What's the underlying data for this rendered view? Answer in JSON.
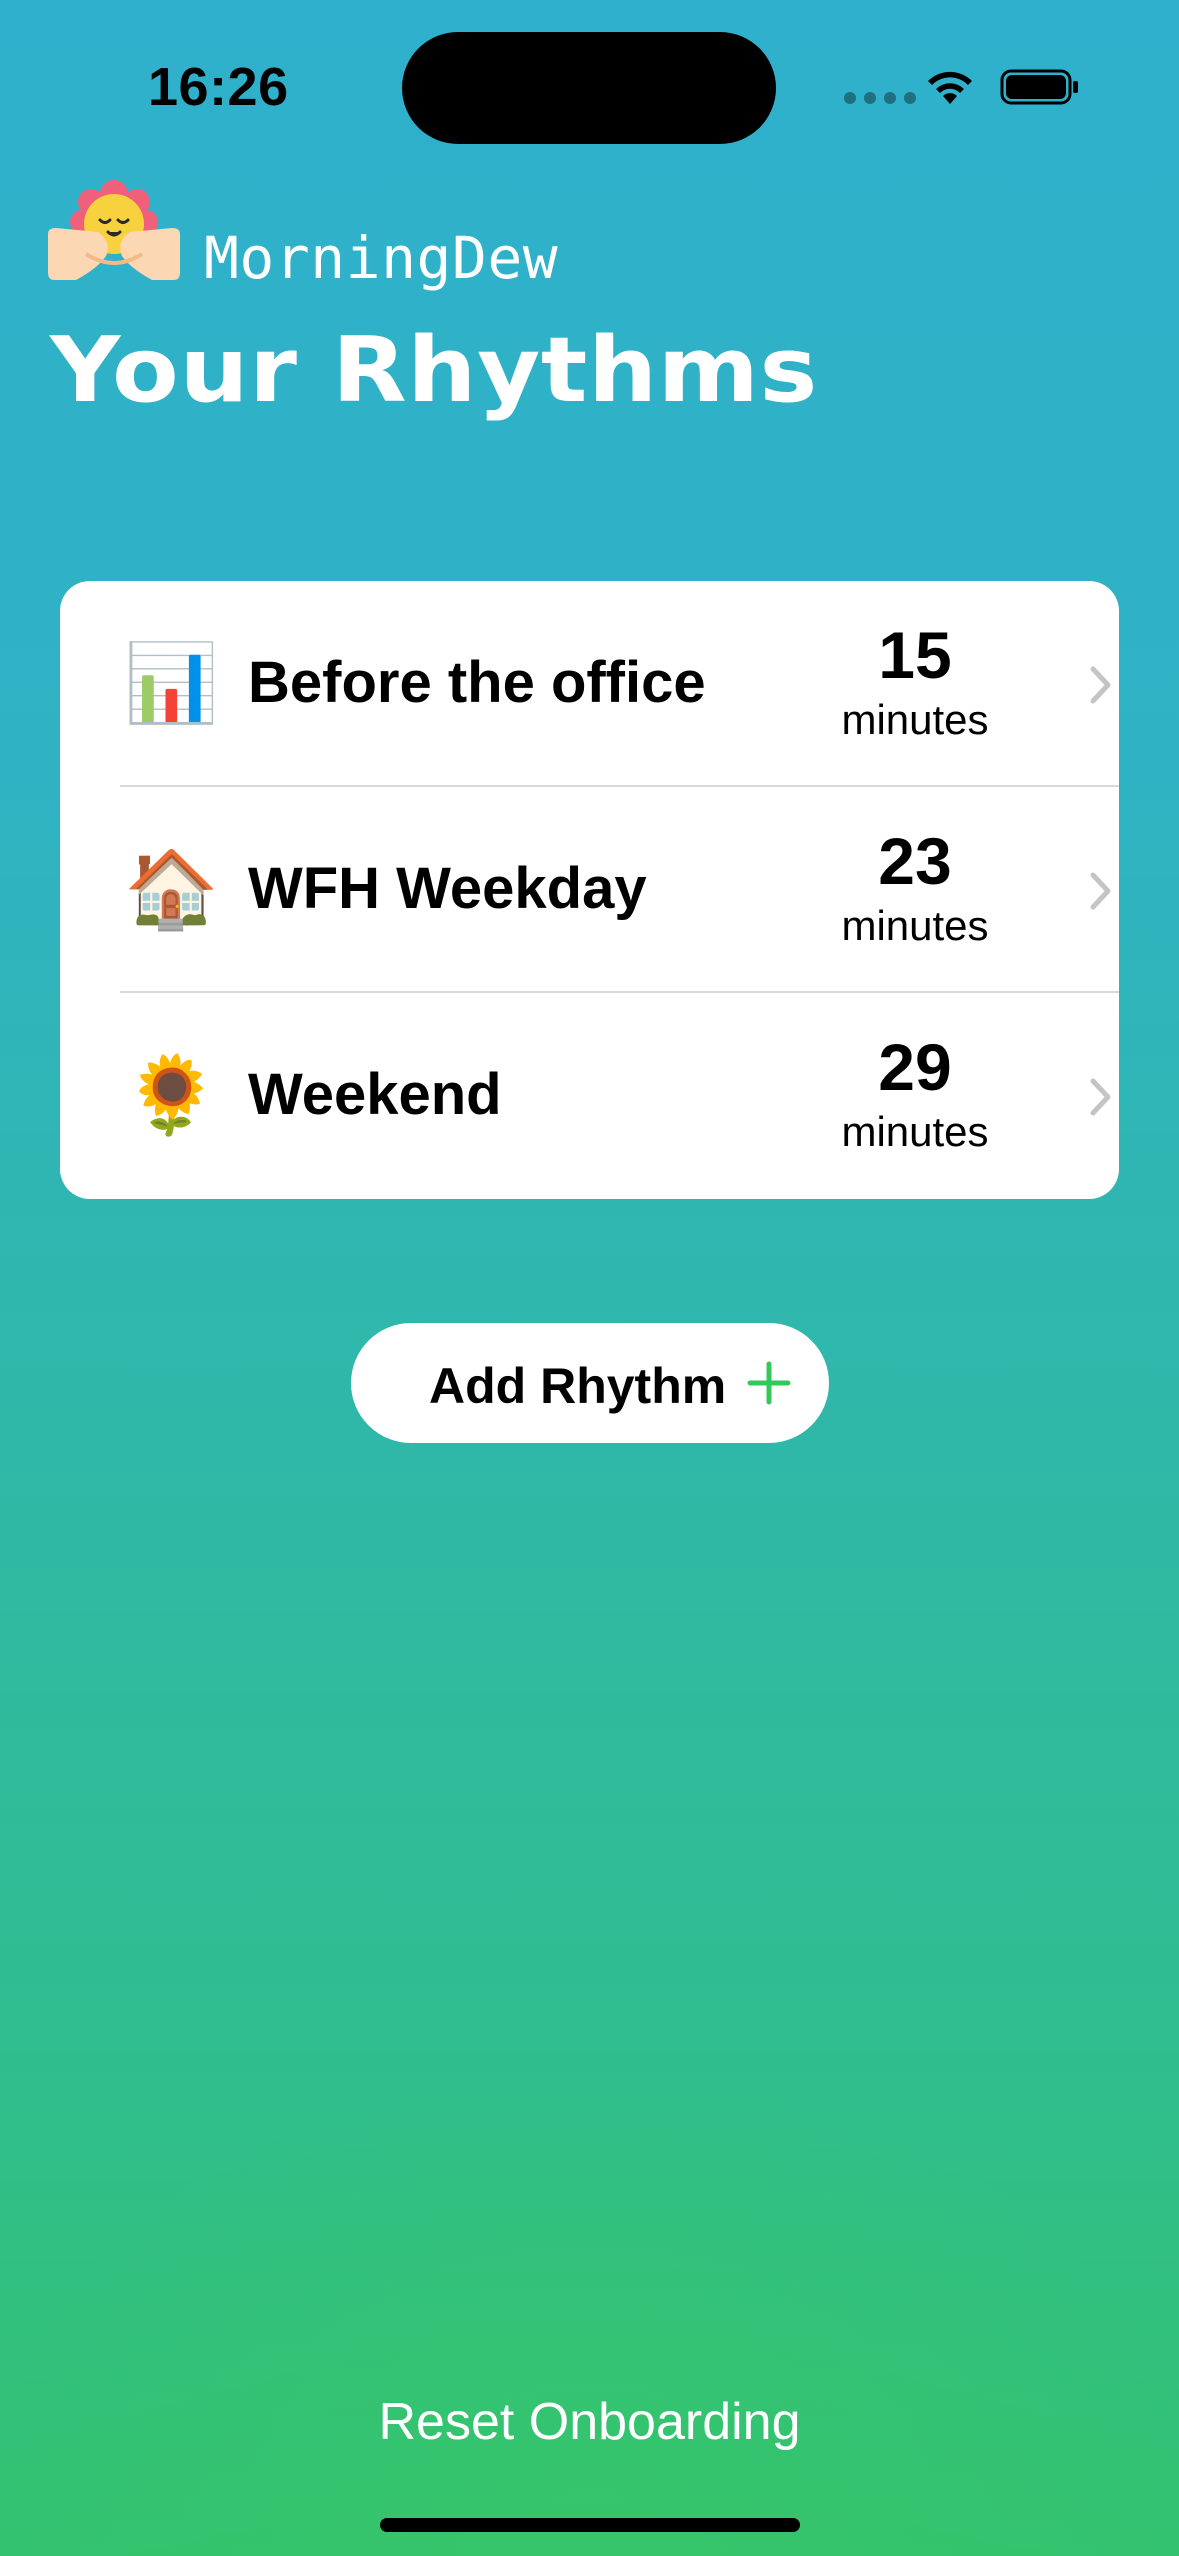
{
  "status_bar": {
    "time": "16:26"
  },
  "header": {
    "app_name": "MorningDew",
    "title": "Your Rhythms",
    "logo_icon": "sun-in-hands-icon"
  },
  "rhythms": [
    {
      "emoji": "📊",
      "icon": "bar-chart-icon",
      "name": "Before the office",
      "minutes": "15",
      "unit": "minutes"
    },
    {
      "emoji": "🏠",
      "icon": "house-icon",
      "name": "WFH Weekday",
      "minutes": "23",
      "unit": "minutes"
    },
    {
      "emoji": "🌻",
      "icon": "sunflower-icon",
      "name": "Weekend",
      "minutes": "29",
      "unit": "minutes"
    }
  ],
  "add_button": {
    "label": "Add Rhythm",
    "icon_color": "#34c759"
  },
  "footer": {
    "reset_label": "Reset Onboarding"
  },
  "colors": {
    "background_top": "#2fb0cc",
    "background_bottom": "#33c26f",
    "card": "#ffffff",
    "accent": "#34c759"
  }
}
